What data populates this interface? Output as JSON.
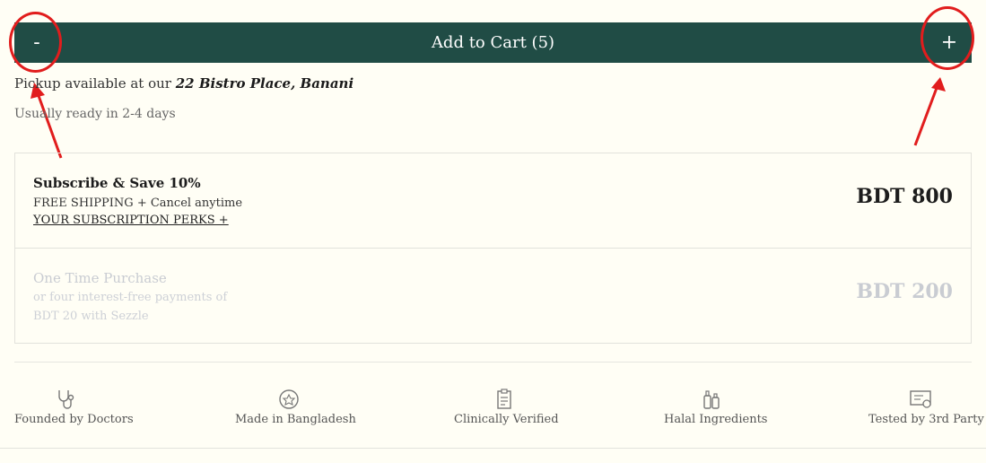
{
  "cart": {
    "minus_label": "-",
    "add_label": "Add to Cart (5)",
    "plus_label": "+"
  },
  "pickup": {
    "prefix": "Pickup available at our ",
    "location": "22 Bistro Place, Banani",
    "ready_text": "Usually ready in 2-4 days"
  },
  "options": [
    {
      "title": "Subscribe & Save 10%",
      "line1": "FREE SHIPPING + Cancel anytime",
      "line2": "YOUR SUBSCRIPTION PERKS +",
      "price": "BDT 800"
    },
    {
      "title": "One Time Purchase",
      "line1": "or four interest-free payments of",
      "line2": "BDT 20 with Sezzle",
      "price": "BDT 200"
    }
  ],
  "badges": [
    {
      "icon": "stethoscope-icon",
      "label": "Founded by Doctors"
    },
    {
      "icon": "badge-seal-icon",
      "label": "Made in Bangladesh"
    },
    {
      "icon": "clipboard-icon",
      "label": "Clinically Verified"
    },
    {
      "icon": "bottles-icon",
      "label": "Halal Ingredients"
    },
    {
      "icon": "certificate-icon",
      "label": "Tested by 3rd Party"
    }
  ],
  "colors": {
    "cart_bar": "#204c45",
    "annotation": "#e11d1d",
    "background": "#fffef5"
  }
}
